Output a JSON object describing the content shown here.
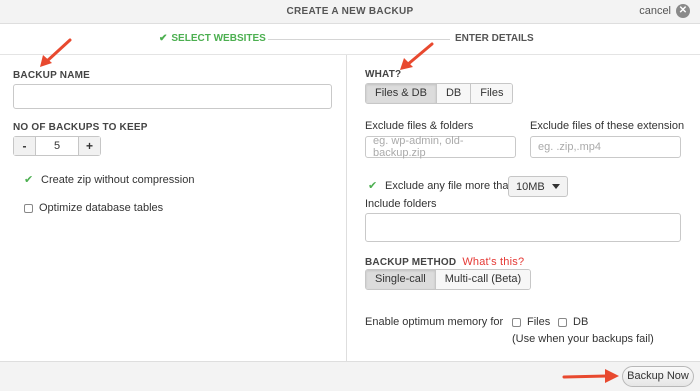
{
  "titlebar": {
    "title": "CREATE A NEW BACKUP",
    "cancel_label": "cancel"
  },
  "steps": {
    "step1": "SELECT WEBSITES",
    "step2": "ENTER DETAILS",
    "step1_complete": true
  },
  "left": {
    "backup_name_label": "BACKUP NAME",
    "backup_name_value": "",
    "keep_label": "NO OF BACKUPS TO KEEP",
    "keep_minus": "-",
    "keep_value": "5",
    "keep_plus": "+",
    "zip_label": "Create zip without compression",
    "zip_checked": true,
    "optimize_label": "Optimize database tables",
    "optimize_checked": false
  },
  "right": {
    "what_label": "WHAT?",
    "what_options": [
      "Files & DB",
      "DB",
      "Files"
    ],
    "what_selected": "Files & DB",
    "exclude_label": "Exclude files & folders",
    "exclude_placeholder": "eg. wp-admin, old-backup.zip",
    "exclude_ext_label": "Exclude files of these extension",
    "exclude_ext_placeholder": "eg. .zip,.mp4",
    "exclude_size_label": "Exclude any file more than",
    "exclude_size_checked": true,
    "exclude_size_value": "10MB",
    "include_label": "Include folders",
    "method_label": "BACKUP METHOD",
    "method_help": "What's this?",
    "method_options": [
      "Single-call",
      "Multi-call (Beta)"
    ],
    "method_selected": "Single-call",
    "memory_label": "Enable optimum memory for",
    "memory_files": "Files",
    "memory_db": "DB",
    "memory_note": "(Use when your backups fail)"
  },
  "footer": {
    "backup_button": "Backup Now"
  },
  "colors": {
    "accent_green": "#4caf50",
    "arrow_red": "#e8492f",
    "help_red": "#e53935"
  }
}
